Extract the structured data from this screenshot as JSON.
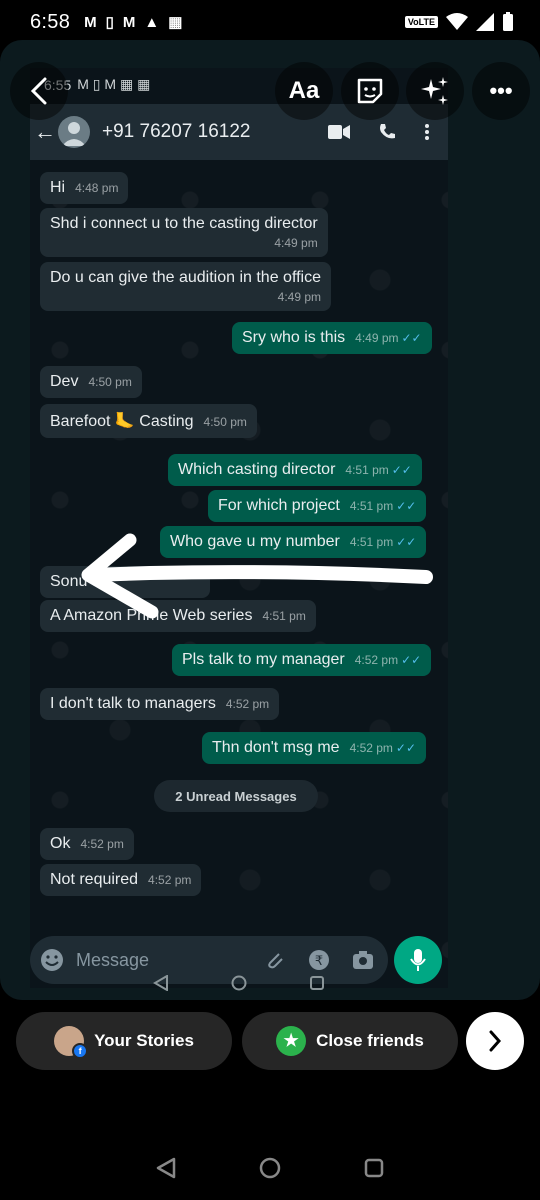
{
  "status_bar": {
    "time": "6:58",
    "notifications": [
      "M",
      "▯",
      "M",
      "▲",
      "▦"
    ],
    "volte": "VoLTE"
  },
  "story_tools": {
    "text_label": "Aa",
    "more_label": "•••"
  },
  "screenshot": {
    "status": {
      "time": "6:55",
      "icons": "M ▯ M ▦ ▦"
    },
    "header": {
      "contact": "+91 76207 16122"
    },
    "messages": [
      {
        "dir": "in",
        "text": "Hi",
        "time": "4:48 pm"
      },
      {
        "dir": "in",
        "text": "Shd i connect u to the casting director",
        "time": "4:49 pm"
      },
      {
        "dir": "in",
        "text": "Do u can give the audition in the office",
        "time": "4:49 pm"
      },
      {
        "dir": "out",
        "text": "Sry who is this",
        "time": "4:49 pm"
      },
      {
        "dir": "in",
        "text": "Dev",
        "time": "4:50 pm"
      },
      {
        "dir": "in",
        "text": "Barefoot 🦶 Casting",
        "time": "4:50 pm"
      },
      {
        "dir": "out",
        "text": "Which casting director",
        "time": "4:51 pm"
      },
      {
        "dir": "out",
        "text": "For which project",
        "time": "4:51 pm"
      },
      {
        "dir": "out",
        "text": "Who gave u my number",
        "time": "4:51 pm"
      },
      {
        "dir": "in",
        "text": "Sonu s",
        "time": ""
      },
      {
        "dir": "in",
        "text": "A Amazon Prime Web series",
        "time": "4:51 pm"
      },
      {
        "dir": "out",
        "text": "Pls talk to my manager",
        "time": "4:52 pm"
      },
      {
        "dir": "in",
        "text": "I don't talk to managers",
        "time": "4:52 pm"
      },
      {
        "dir": "out",
        "text": "Thn don't msg me",
        "time": "4:52 pm"
      },
      {
        "dir": "in",
        "text": "Ok",
        "time": "4:52 pm"
      },
      {
        "dir": "in",
        "text": "Not required",
        "time": "4:52 pm"
      }
    ],
    "unread_label": "2 Unread Messages",
    "input_placeholder": "Message"
  },
  "share_bar": {
    "your_stories": "Your Stories",
    "close_friends": "Close friends"
  }
}
